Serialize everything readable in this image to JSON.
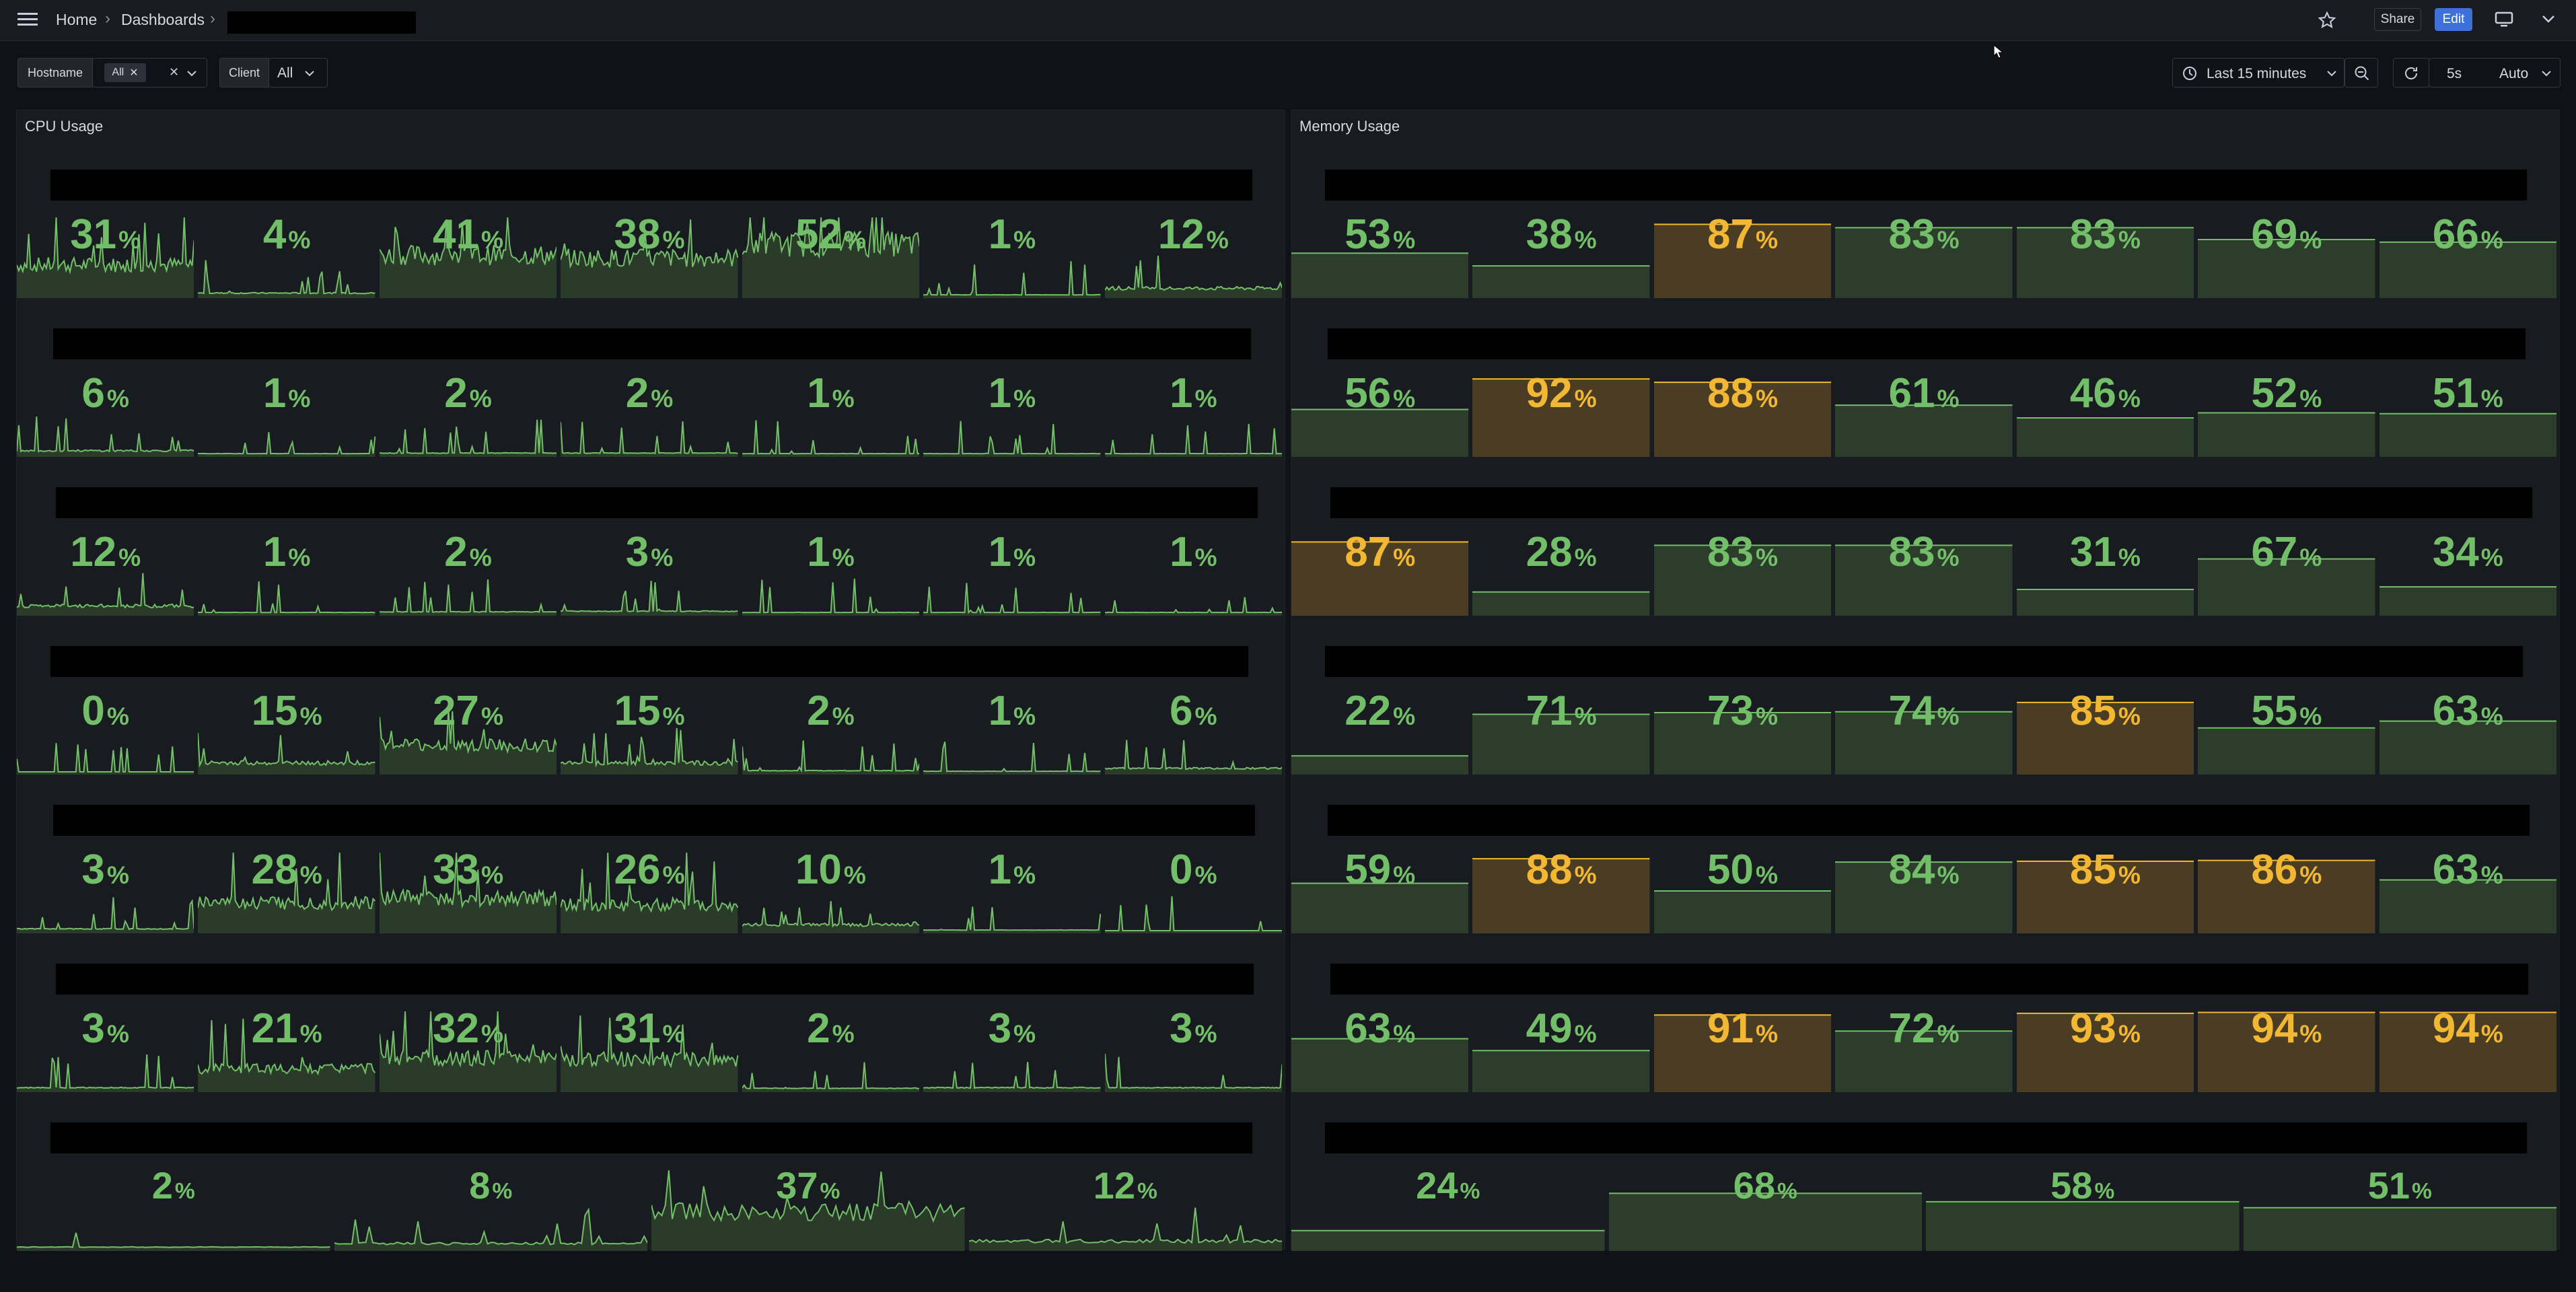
{
  "breadcrumb": {
    "home": "Home",
    "dashboards": "Dashboards"
  },
  "toolbar": {
    "share": "Share",
    "edit": "Edit"
  },
  "variables": [
    {
      "label": "Hostname",
      "value": "All"
    },
    {
      "label": "Client",
      "value": "All"
    }
  ],
  "time": {
    "range": "Last 15 minutes",
    "refresh": "5s",
    "zoom": "Auto"
  },
  "colors": {
    "green": "#73bf69",
    "green_fill": "#2c3d2c",
    "amber": "#f2b733",
    "amber_fill": "#4a3d23"
  },
  "panels": {
    "cpu": {
      "title": "CPU Usage",
      "unit": "%",
      "rows": [
        [
          31,
          4,
          41,
          38,
          52,
          1,
          12
        ],
        [
          6,
          1,
          2,
          2,
          1,
          1,
          1
        ],
        [
          12,
          1,
          2,
          3,
          1,
          1,
          1
        ],
        [
          0,
          15,
          27,
          15,
          2,
          1,
          6
        ],
        [
          3,
          28,
          33,
          26,
          10,
          1,
          0
        ],
        [
          3,
          21,
          32,
          31,
          2,
          3,
          3
        ],
        [
          2,
          8,
          37,
          12
        ]
      ]
    },
    "memory": {
      "title": "Memory Usage",
      "unit": "%",
      "warn_threshold": 85,
      "rows": [
        [
          53,
          38,
          87,
          83,
          83,
          69,
          66
        ],
        [
          56,
          92,
          88,
          61,
          46,
          52,
          51
        ],
        [
          87,
          28,
          83,
          83,
          31,
          67,
          34
        ],
        [
          22,
          71,
          73,
          74,
          85,
          55,
          63
        ],
        [
          59,
          88,
          50,
          84,
          85,
          86,
          63
        ],
        [
          63,
          49,
          91,
          72,
          93,
          94,
          94
        ],
        [
          24,
          68,
          58,
          51
        ]
      ]
    }
  }
}
